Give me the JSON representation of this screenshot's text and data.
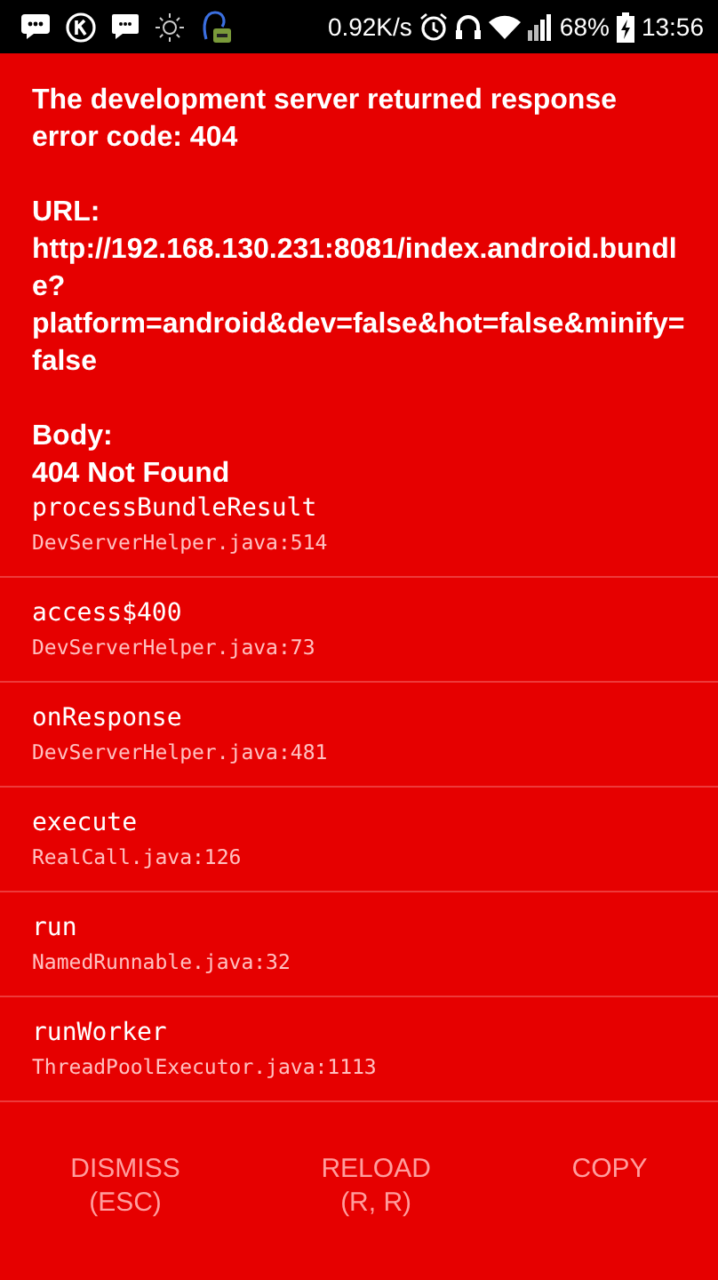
{
  "status_bar": {
    "network_speed": "0.92K/s",
    "battery": "68%",
    "time": "13:56"
  },
  "message": [
    "The development server returned response error code: 404",
    "URL: http://192.168.130.231:8081/index.android.bundle?platform=android&dev=false&hot=false&minify=false",
    "Body:\n404 Not Found"
  ],
  "stack": [
    {
      "method": "processBundleResult",
      "file": "DevServerHelper.java:514"
    },
    {
      "method": "access$400",
      "file": "DevServerHelper.java:73"
    },
    {
      "method": "onResponse",
      "file": "DevServerHelper.java:481"
    },
    {
      "method": "execute",
      "file": "RealCall.java:126"
    },
    {
      "method": "run",
      "file": "NamedRunnable.java:32"
    },
    {
      "method": "runWorker",
      "file": "ThreadPoolExecutor.java:1113"
    }
  ],
  "buttons": [
    "DISMISS\n(ESC)",
    "RELOAD\n(R, R)",
    "COPY"
  ]
}
